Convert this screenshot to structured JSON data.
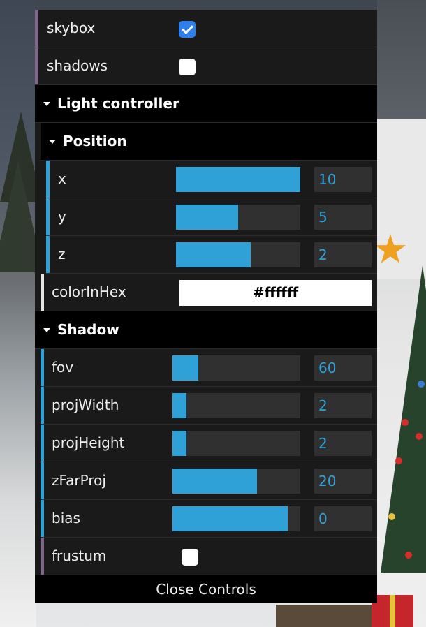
{
  "gui": {
    "skybox": {
      "label": "skybox",
      "checked": true
    },
    "shadows": {
      "label": "shadows",
      "checked": false
    },
    "light_controller": {
      "title": "Light controller",
      "position": {
        "title": "Position",
        "x": {
          "label": "x",
          "value": "10",
          "fill": 1.0
        },
        "y": {
          "label": "y",
          "value": "5",
          "fill": 0.5
        },
        "z": {
          "label": "z",
          "value": "2",
          "fill": 0.6
        }
      },
      "color": {
        "label": "colorInHex",
        "value": "#ffffff"
      }
    },
    "shadow": {
      "title": "Shadow",
      "fov": {
        "label": "fov",
        "value": "60",
        "fill": 0.2
      },
      "projWidth": {
        "label": "projWidth",
        "value": "2",
        "fill": 0.11
      },
      "projHeight": {
        "label": "projHeight",
        "value": "2",
        "fill": 0.11
      },
      "zFarProj": {
        "label": "zFarProj",
        "value": "20",
        "fill": 0.66
      },
      "bias": {
        "label": "bias",
        "value": "0",
        "fill": 0.9
      },
      "frustum": {
        "label": "frustum",
        "checked": false
      }
    },
    "close_label": "Close Controls"
  },
  "colors": {
    "accent": "#2fa1d6",
    "boolean_edge": "#806787",
    "panel": "#1a1a1a",
    "checkbox_on": "#2f80ed"
  }
}
